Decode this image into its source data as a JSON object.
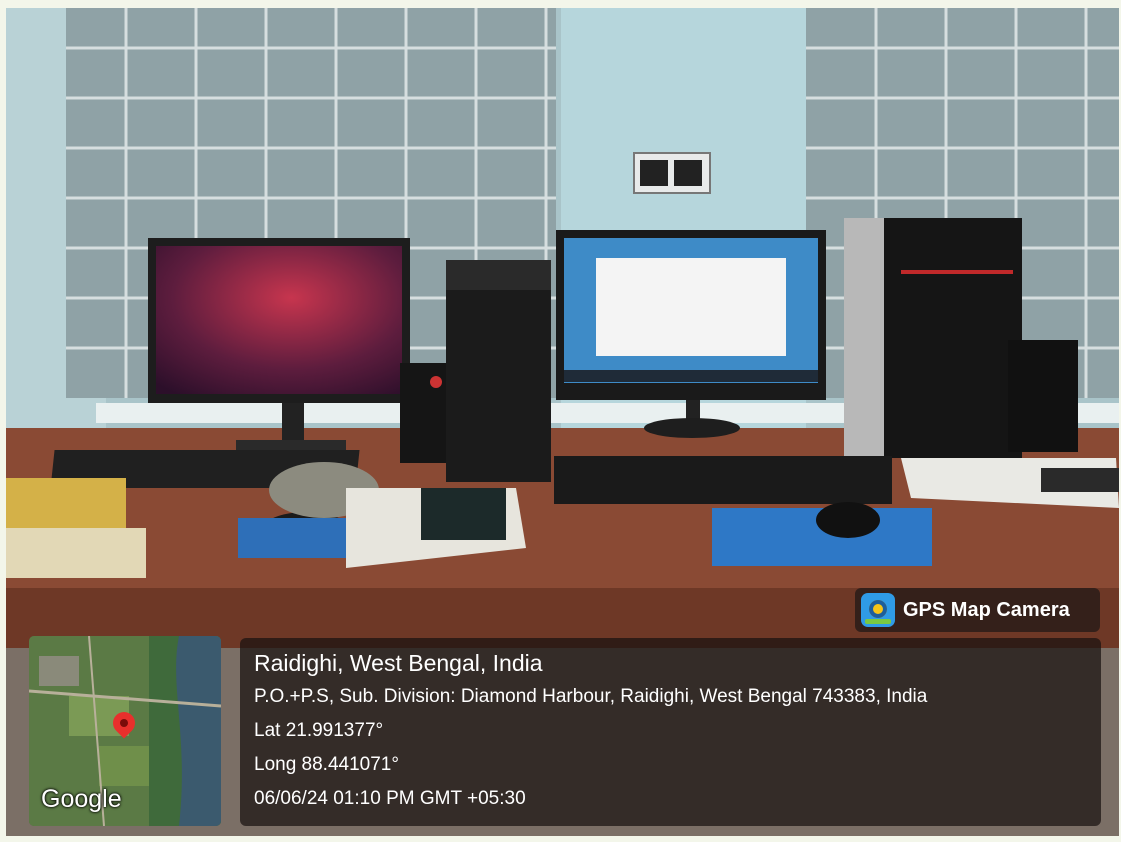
{
  "badge": {
    "label": "GPS Map Camera",
    "icon": "gps-map-camera-icon"
  },
  "location": {
    "title": "Raidighi, West Bengal, India",
    "address": "P.O.+P.S, Sub. Division: Diamond Harbour, Raidighi, West Bengal 743383, India",
    "lat": "Lat 21.991377°",
    "long": "Long 88.441071°",
    "datetime": "06/06/24 01:10 PM GMT +05:30"
  },
  "map": {
    "brand": "Google",
    "marker_icon": "map-pin-icon"
  },
  "colors": {
    "page_bg": "#f3f6ea",
    "overlay": "#1e1816",
    "pin": "#e8302c"
  }
}
